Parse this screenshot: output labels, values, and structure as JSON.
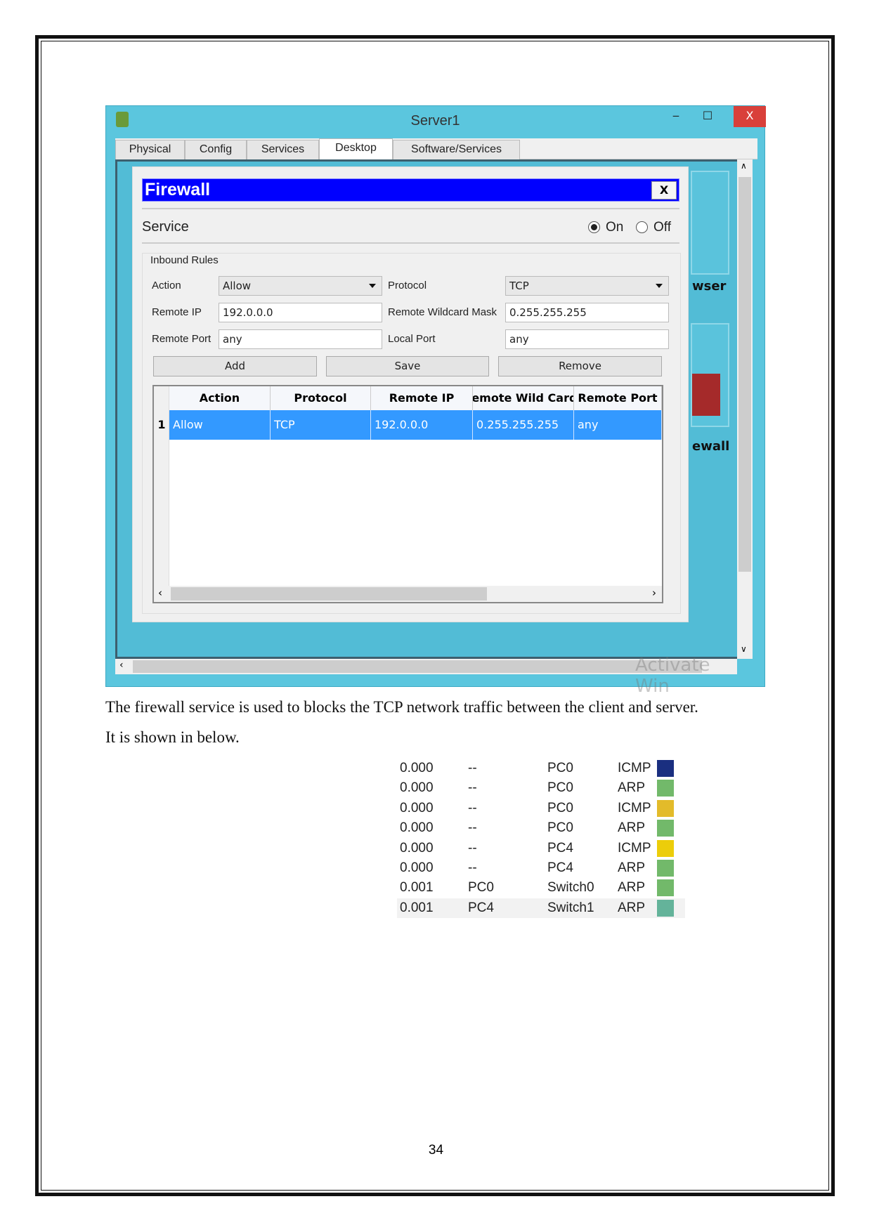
{
  "window": {
    "title": "Server1",
    "minimize": "‒",
    "maximize": "☐",
    "close": "X",
    "tabs": [
      "Physical",
      "Config",
      "Services",
      "Desktop",
      "Software/Services"
    ],
    "active_tab": "Desktop",
    "background_icons": [
      "wser",
      "ewall"
    ],
    "watermark": "Activate Win"
  },
  "firewall": {
    "title": "Firewall",
    "close": "X",
    "service_label": "Service",
    "on": "On",
    "off": "Off",
    "service_state": "On",
    "group": "Inbound Rules",
    "action_label": "Action",
    "action_value": "Allow",
    "protocol_label": "Protocol",
    "protocol_value": "TCP",
    "remote_ip_label": "Remote IP",
    "remote_ip_value": "192.0.0.0",
    "mask_label": "Remote Wildcard Mask",
    "mask_value": "0.255.255.255",
    "remote_port_label": "Remote Port",
    "remote_port_value": "any",
    "local_port_label": "Local Port",
    "local_port_value": "any",
    "add": "Add",
    "save": "Save",
    "remove": "Remove",
    "columns": [
      "Action",
      "Protocol",
      "Remote IP",
      "Remote Wild Card",
      "Remote Port"
    ],
    "rows": [
      {
        "num": "1",
        "cells": [
          "Allow",
          "TCP",
          "192.0.0.0",
          "0.255.255.255",
          "any"
        ]
      }
    ]
  },
  "paragraph": {
    "line1": "The firewall service is used to blocks the TCP network traffic between the client and server.",
    "line2": "It is shown in below."
  },
  "events": [
    {
      "time": "0.000",
      "last": "--",
      "at": "PC0",
      "type": "ICMP",
      "color": "#1a2f80"
    },
    {
      "time": "0.000",
      "last": "--",
      "at": "PC0",
      "type": "ARP",
      "color": "#72b96a"
    },
    {
      "time": "0.000",
      "last": "--",
      "at": "PC0",
      "type": "ICMP",
      "color": "#e3bb2a"
    },
    {
      "time": "0.000",
      "last": "--",
      "at": "PC0",
      "type": "ARP",
      "color": "#72b96a"
    },
    {
      "time": "0.000",
      "last": "--",
      "at": "PC4",
      "type": "ICMP",
      "color": "#eccd0a"
    },
    {
      "time": "0.000",
      "last": "--",
      "at": "PC4",
      "type": "ARP",
      "color": "#72b96a"
    },
    {
      "time": "0.001",
      "last": "PC0",
      "at": "Switch0",
      "type": "ARP",
      "color": "#72b96a"
    },
    {
      "time": "0.001",
      "last": "PC4",
      "at": "Switch1",
      "type": "ARP",
      "color": "#64b39a"
    }
  ],
  "page_number": "34"
}
